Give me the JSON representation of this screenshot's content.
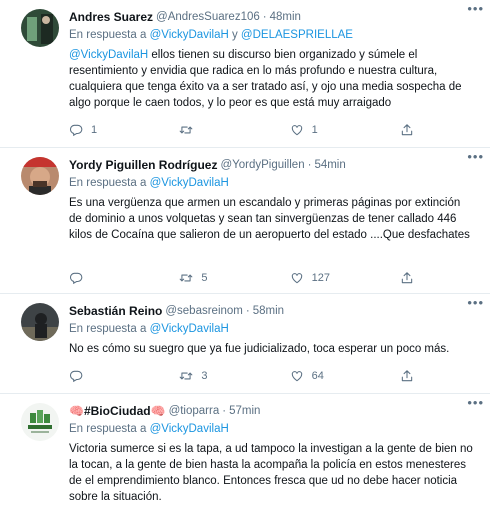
{
  "tweets": [
    {
      "name": "Andres Suarez",
      "handle": "@AndresSuarez106",
      "sep": "·",
      "time": "48min",
      "reply_prefix": "En respuesta a",
      "reply_to": "@VickyDavilaH",
      "reply_join": "y",
      "reply_to2": "@DELAESPRIELLAE",
      "mention": "@VickyDavilaH",
      "text": " ellos tienen su discurso bien organizado y súmele el resentimiento y envidia que radica en lo más profundo e nuestra cultura, cualquiera que tenga éxito va a ser tratado así, y ojo una media sospecha de algo porque le caen todos, y lo peor es que está muy arraigado",
      "replies": "1",
      "retweets": "",
      "likes": "1"
    },
    {
      "name": "Yordy Piguillen Rodríguez",
      "handle": "@YordyPiguillen",
      "sep": "·",
      "time": "54min",
      "reply_prefix": "En respuesta a",
      "reply_to": "@VickyDavilaH",
      "text": "Es una vergüenza que armen un escandalo y primeras páginas por extinción de dominio a unos volquetas y sean tan sinvergüenzas de tener callado 446 kilos de Cocaína que salieron de un aeropuerto del estado ....Que desfachates",
      "replies": "",
      "retweets": "5",
      "likes": "127"
    },
    {
      "name": "Sebastián Reino",
      "handle": "@sebasreinom",
      "sep": "·",
      "time": "58min",
      "reply_prefix": "En respuesta a",
      "reply_to": "@VickyDavilaH",
      "text": "No es cómo su suegro que ya fue judicializado, toca esperar un poco más.",
      "replies": "",
      "retweets": "3",
      "likes": "64"
    },
    {
      "name": "🧠#BioCiudad🧠",
      "handle": "@tioparra",
      "sep": "·",
      "time": "57min",
      "reply_prefix": "En respuesta a",
      "reply_to": "@VickyDavilaH",
      "text": "Victoria sumerce si es la tapa, a ud tampoco la investigan a la gente de bien no la tocan, a la gente de bien hasta la acompaña la policía en estos menesteres de el emprendimiento blanco. Entonces fresca que ud no debe hacer noticia sobre la situación."
    }
  ],
  "icons": {
    "more": "more-icon",
    "reply": "reply-icon",
    "retweet": "retweet-icon",
    "like": "like-icon",
    "share": "share-icon"
  },
  "colors": {
    "link": "#1b95e0",
    "secondary": "#5b7083",
    "divider": "#e6ecf0"
  }
}
